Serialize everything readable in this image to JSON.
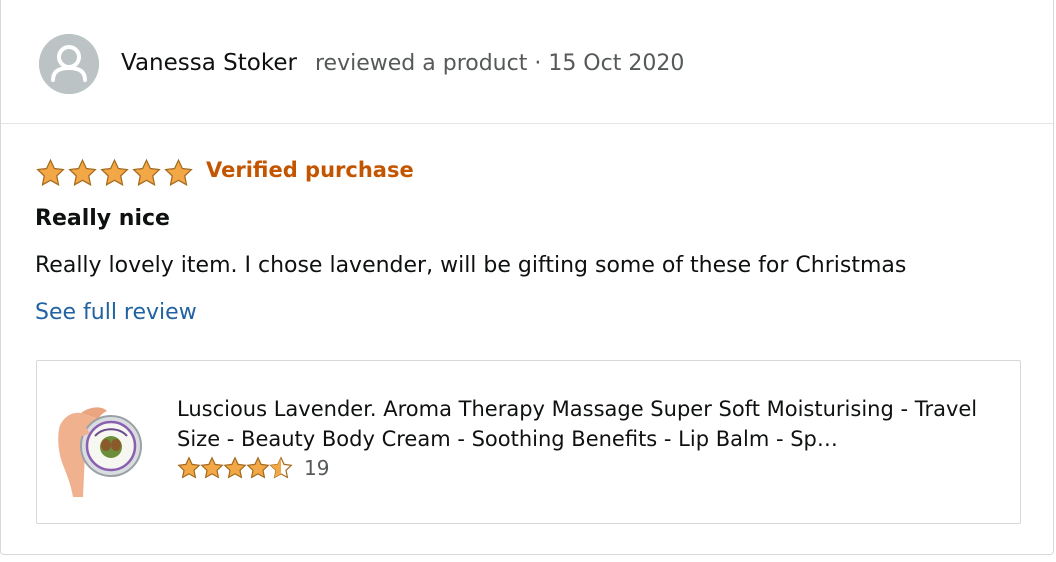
{
  "review": {
    "reviewer_name": "Vanessa Stoker",
    "action_text": "reviewed a product · 15 Oct 2020",
    "rating": 5,
    "verified_label": "Verified purchase",
    "title": "Really nice",
    "body": "Really lovely item. I chose lavender, will be gifting some of these for Christmas",
    "see_full_label": "See full review"
  },
  "product": {
    "name": "Luscious Lavender. Aroma Therapy Massage Super Soft Moisturising - Travel Size - Beauty Body Cream - Soothing Benefits - Lip Balm - Sp…",
    "rating": 4.5,
    "rating_count": "19"
  },
  "colors": {
    "star": "#f3a847",
    "verified": "#c45500",
    "link": "#2162a1",
    "avatar": "#bcc3c5"
  }
}
